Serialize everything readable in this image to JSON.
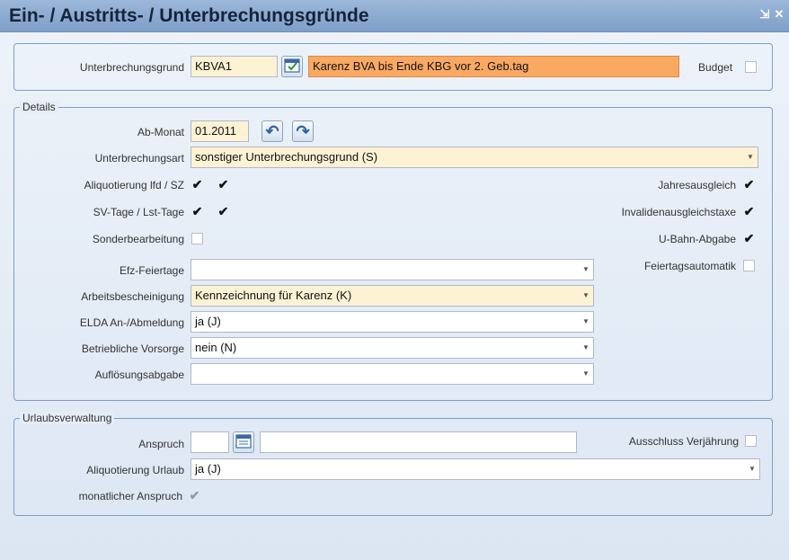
{
  "window": {
    "title": "Ein- / Austritts- / Unterbrechungsgründe",
    "minimize_glyph": "⇲",
    "close_glyph": "✕"
  },
  "top": {
    "reason_label": "Unterbrechungsgrund",
    "reason_code": "KBVA1",
    "reason_text": "Karenz BVA bis Ende KBG vor 2. Geb.tag",
    "budget_label": "Budget",
    "budget_checked": false
  },
  "details": {
    "legend": "Details",
    "ab_monat_label": "Ab-Monat",
    "ab_monat_value": "01.2011",
    "art_label": "Unterbrechungsart",
    "art_value": "sonstiger Unterbrechungsgrund (S)",
    "aliq_label": "Aliquotierung lfd / SZ",
    "sv_label": "SV-Tage / Lst-Tage",
    "sonder_label": "Sonderbearbeitung",
    "jahres_label": "Jahresausgleich",
    "invalid_label": "Invalidenausgleichstaxe",
    "ubahn_label": "U-Bahn-Abgabe",
    "feiertagsauto_label": "Feiertagsautomatik",
    "efz_label": "Efz-Feiertage",
    "efz_value": "",
    "arbeits_label": "Arbeitsbescheinigung",
    "arbeits_value": "Kennzeichnung für Karenz (K)",
    "elda_label": "ELDA An-/Abmeldung",
    "elda_value": "ja (J)",
    "vorsorge_label": "Betriebliche Vorsorge",
    "vorsorge_value": "nein (N)",
    "aufl_label": "Auflösungsabgabe",
    "aufl_value": ""
  },
  "urlaub": {
    "legend": "Urlaubsverwaltung",
    "anspruch_label": "Anspruch",
    "anspruch_value": "",
    "anspruch_text": "",
    "ausschluss_label": "Ausschluss Verjährung",
    "aliq_label": "Aliquotierung Urlaub",
    "aliq_value": "ja (J)",
    "monatlich_label": "monatlicher Anspruch"
  },
  "glyphs": {
    "check": "✔",
    "dropdown": "▼",
    "undo": "↶",
    "redo": "↷"
  }
}
